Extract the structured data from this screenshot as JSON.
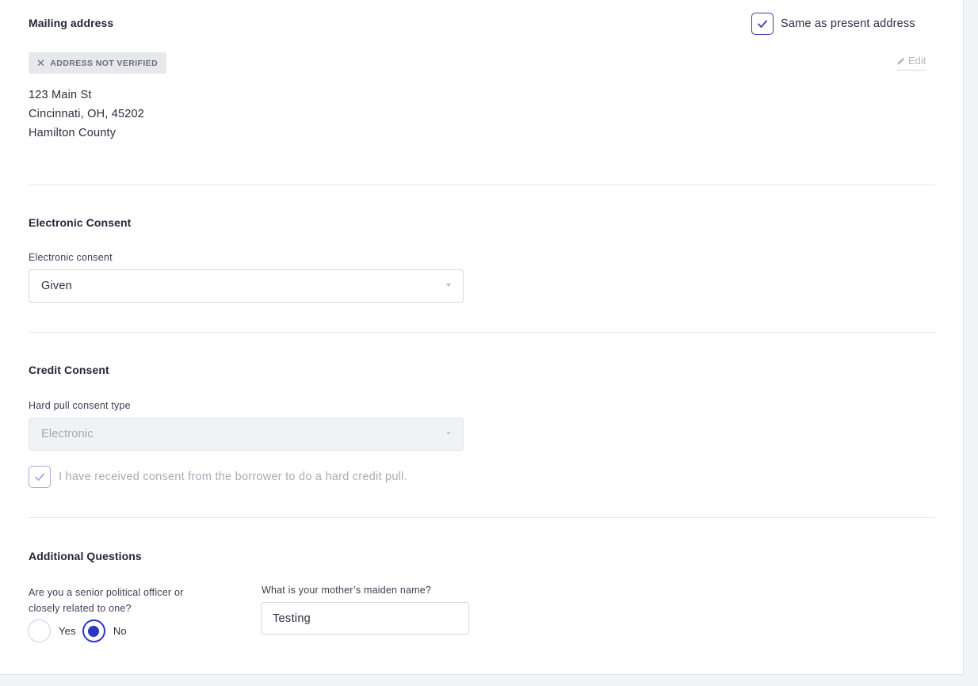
{
  "mailing": {
    "title": "Mailing address",
    "same_as_present_label": "Same as present address",
    "same_as_present_checked": true,
    "badge_icon": "close-icon",
    "badge_text": "ADDRESS NOT VERIFIED",
    "edit_icon": "pencil-icon",
    "edit_label": "Edit",
    "address_lines": [
      "123 Main St",
      "Cincinnati, OH, 45202",
      "Hamilton County"
    ]
  },
  "electronic_consent": {
    "title": "Electronic Consent",
    "label": "Electronic consent",
    "value": "Given"
  },
  "credit_consent": {
    "title": "Credit Consent",
    "label": "Hard pull consent type",
    "value": "Electronic",
    "checkbox_label": "I have received consent from the borrower to do a hard credit pull.",
    "checkbox_checked": true
  },
  "additional": {
    "title": "Additional Questions",
    "political_question_line1": "Are you a senior political officer or",
    "political_question_line2": "closely related to one?",
    "yes_label": "Yes",
    "no_label": "No",
    "selected": "No",
    "maiden_question": "What is your mother’s maiden name?",
    "maiden_value": "Testing"
  },
  "colors": {
    "accent": "#2b36c8",
    "checkbox_border": "#3c3fae",
    "badge_bg": "#e7e8ec"
  }
}
